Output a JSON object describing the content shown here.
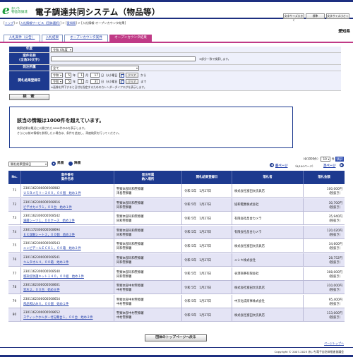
{
  "header": {
    "logo_mark": "e",
    "logo_small": "あいち",
    "logo_sub": "物品等調達",
    "system_title": "電子調達共同システム（物品等）",
    "buttons": [
      "文字サイズ大きく",
      "標準",
      "文字サイズ小さく"
    ]
  },
  "breadcrumb": {
    "items": [
      "トップ",
      "入札情報サービス（団体選択）",
      "愛知県"
    ],
    "current": "入札情報-オープンカウンタ結果"
  },
  "region": "愛知県",
  "tabs": [
    {
      "label": "入札案件（公告）",
      "active": false
    },
    {
      "label": "入札結果",
      "active": false
    },
    {
      "label": "オープンカウンタ案件",
      "active": false
    },
    {
      "label": "オープンカウンタ結果",
      "active": true
    }
  ],
  "form": {
    "nendo_label": "年度",
    "nendo_value": "令和 4年度",
    "anken_label1": "案件名称",
    "anken_label2": "(全角50文字)",
    "anken_value": "",
    "anken_note": "※部分一致で検索します。",
    "hacchu_label": "発注所属",
    "hacchu_value": "全て",
    "date_label": "開札結果登録日",
    "from": {
      "era": "令和",
      "year": "5",
      "month": "1",
      "day": "17",
      "weekday": "(火)",
      "weekday_word": "曜日",
      "clear": "クリア",
      "suffix": "から"
    },
    "to": {
      "era": "令和",
      "year": "5",
      "month": "1",
      "day": "31",
      "weekday": "(火)",
      "weekday_word": "曜日",
      "clear": "クリア",
      "suffix": "まで"
    },
    "unit_year": "年",
    "unit_month": "月",
    "unit_day": "日",
    "date_note": "※画像を押下すると日付を指定するためのカレンダーダイアログを表示します。",
    "search_button": "検 索"
  },
  "notice": {
    "title": "該当の情報は1000件を超えています。",
    "line1": "検索結果は最近に公開された1000件のみを表示します。",
    "line2": "さらに以前の情報を参照したい場合は、条件を追加し、再度検索を行ってください。"
  },
  "list": {
    "summary_prefix": "（全1000件）",
    "per_page": "10",
    "summary_suffix": "件",
    "display_button": "表示",
    "sort_field": "開札結果登録日",
    "sort_asc": "昇順",
    "sort_desc": "降順",
    "prev": "前ページ",
    "page_info": "（8/100ページ）",
    "next": "次ページ",
    "headers": {
      "no": "No.",
      "anken_no": "案件番号",
      "anken_name": "案件名称",
      "hacchu": "発注所属",
      "nonyu": "納入場所",
      "date": "開札結果登録日",
      "winner": "落札者",
      "amount": "落札金額"
    },
    "rows": [
      {
        "no": "71",
        "code": "2301162300000508982",
        "name": "ＵＳＢメモリー２００，００個　始め１件",
        "dept": "警察本部同和警察署",
        "place": "津島警察署",
        "date": "令和 5年　1月27日",
        "winner": "株式会社富田文房具店",
        "amount": "100,000円",
        "tax": "（税抜き）"
      },
      {
        "no": "72",
        "code": "2301162300000508916",
        "name": "ビデオカメラ１，００台　始め１件",
        "dept": "警察本部同和警察署",
        "place": "同和警察署",
        "date": "令和 5年　1月27日",
        "winner": "協和電業株式会社",
        "amount": "30,700円",
        "tax": "（税抜き）"
      },
      {
        "no": "73",
        "code": "2301162300000508542",
        "name": "滅菌シーツ１，００ケース　始め１件",
        "dept": "警察本部同和警察署",
        "place": "同和警察署",
        "date": "令和 5年　1月27日",
        "winner": "有限会社昌台カメラ",
        "amount": "35,940円",
        "tax": "（税抜き）"
      },
      {
        "no": "74",
        "code": "2301172300000508694",
        "name": "ＥＸ双眼シート３，００個　始め３件",
        "dept": "警察本部同和警察署",
        "place": "同和警察署",
        "date": "令和 5年　1月27日",
        "winner": "有限会社昌台カメラ",
        "amount": "120,020円",
        "tax": "（税抜き）"
      },
      {
        "no": "75",
        "code": "2301162300000508543",
        "name": "ニンビデールＥＣＯ１，００箱　始め２件",
        "dept": "警察本部同和警察署",
        "place": "同和警察署",
        "date": "令和 5年　1月27日",
        "winner": "株式会社富田文房具店",
        "amount": "34,600円",
        "tax": "（税抜き）"
      },
      {
        "no": "76",
        "code": "2301162300000508541",
        "name": "キムタオル４，００箱　始め１件",
        "dept": "警察本部同和警察署",
        "place": "同和警察署",
        "date": "令和 5年　1月27日",
        "winner": "ニシキ株式会社",
        "amount": "28,752円",
        "tax": "（税抜き）"
      },
      {
        "no": "77",
        "code": "2301162300000508540",
        "name": "感染症防護キット１４０，００組　始め１件",
        "dept": "警察本部同和警察署",
        "place": "同和警察署",
        "date": "令和 5年　1月27日",
        "winner": "谷澤商事有限会社",
        "amount": "308,000円",
        "tax": "（税抜き）"
      },
      {
        "no": "78",
        "code": "2301162300000508601",
        "name": "室木２，００台　始め８件",
        "dept": "警察本部中村警察署",
        "place": "中村警察署",
        "date": "令和 5年　1月27日",
        "winner": "株式会社富田文房具店",
        "amount": "310,000円",
        "tax": "（税抜き）"
      },
      {
        "no": "79",
        "code": "2301162300000508654",
        "name": "部品照込み６，００個　始め１件",
        "dept": "警察本部中村警察署",
        "place": "中村警察署",
        "date": "令和 5年　1月27日",
        "winner": "中京化成商事株式会社",
        "amount": "95,400円",
        "tax": "（税抜き）"
      },
      {
        "no": "80",
        "code": "2301162300000508652",
        "name": "スティックホルダー付記載台１，００台　始め２件",
        "dept": "警察本部中村警察署",
        "place": "中村警察署",
        "date": "令和 5年　1月27日",
        "winner": "株式会社富田文房具店",
        "amount": "113,000円",
        "tax": "（税抜き）"
      }
    ]
  },
  "footer": {
    "back_button": "団体のトップページへ戻る",
    "page_top": "ページトップへ",
    "copyright": "Copyright © 2007-2023 あいち電子自治体推進協議会"
  }
}
